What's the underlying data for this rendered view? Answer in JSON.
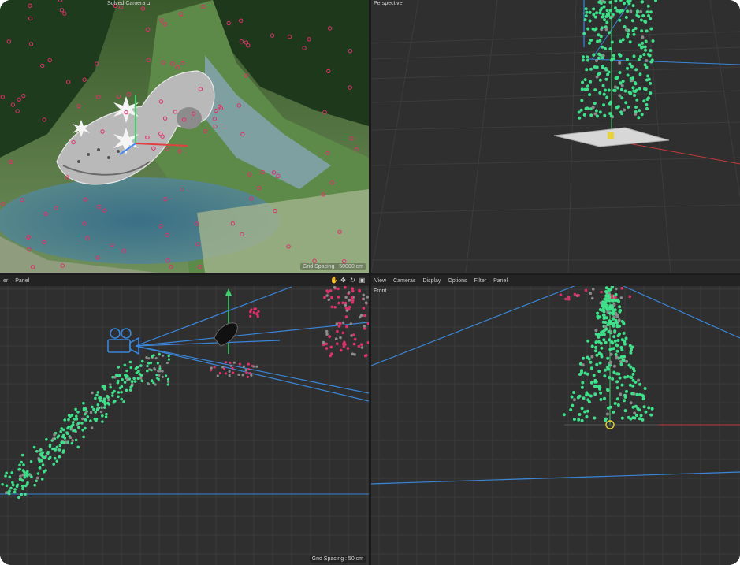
{
  "viewports": {
    "camera": {
      "title": "Solved Camera",
      "grid_spacing": "Grid Spacing : 50000 cm"
    },
    "perspective": {
      "title": "Perspective"
    },
    "top": {
      "menu": [
        "er",
        "Panel"
      ],
      "grid_spacing": "Grid Spacing : 50 cm"
    },
    "front": {
      "menu": [
        "View",
        "Cameras",
        "Display",
        "Options",
        "Filter",
        "Panel"
      ],
      "title": "Front"
    }
  },
  "colors": {
    "viewport_bg": "#2f2f2f",
    "grid": "#3b3b3b",
    "track_green": "#3fe08a",
    "track_red": "#e0306a",
    "camera_line": "#3a86d8",
    "axis_red": "#c33a3a"
  }
}
